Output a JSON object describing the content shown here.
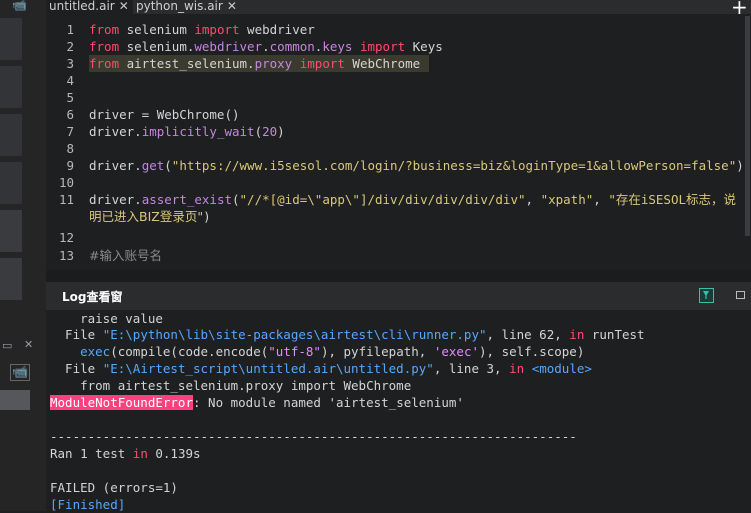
{
  "tabs": [
    {
      "label": "untitled.air",
      "close": "✕"
    },
    {
      "label": "python_wis.air",
      "close": "✕"
    }
  ],
  "new_tab_label": "+",
  "line_numbers": [
    "1",
    "2",
    "3",
    "4",
    "5",
    "6",
    "7",
    "8",
    "9",
    "10",
    "11",
    "12",
    "13"
  ],
  "log_title": "Log查看窗",
  "editor_colors": {
    "keyword": "#ff4b6e",
    "function": "#c586e0",
    "string": "#d9c87a",
    "path": "#55a8ff",
    "error_bg": "#ff3f7e"
  },
  "left_icons": [
    "camera-icon",
    "window-icon",
    "close-icon",
    "record-icon"
  ],
  "left_glyphs": {
    "camera": "📹",
    "window": "▭",
    "close": "✕",
    "record": "📹"
  }
}
